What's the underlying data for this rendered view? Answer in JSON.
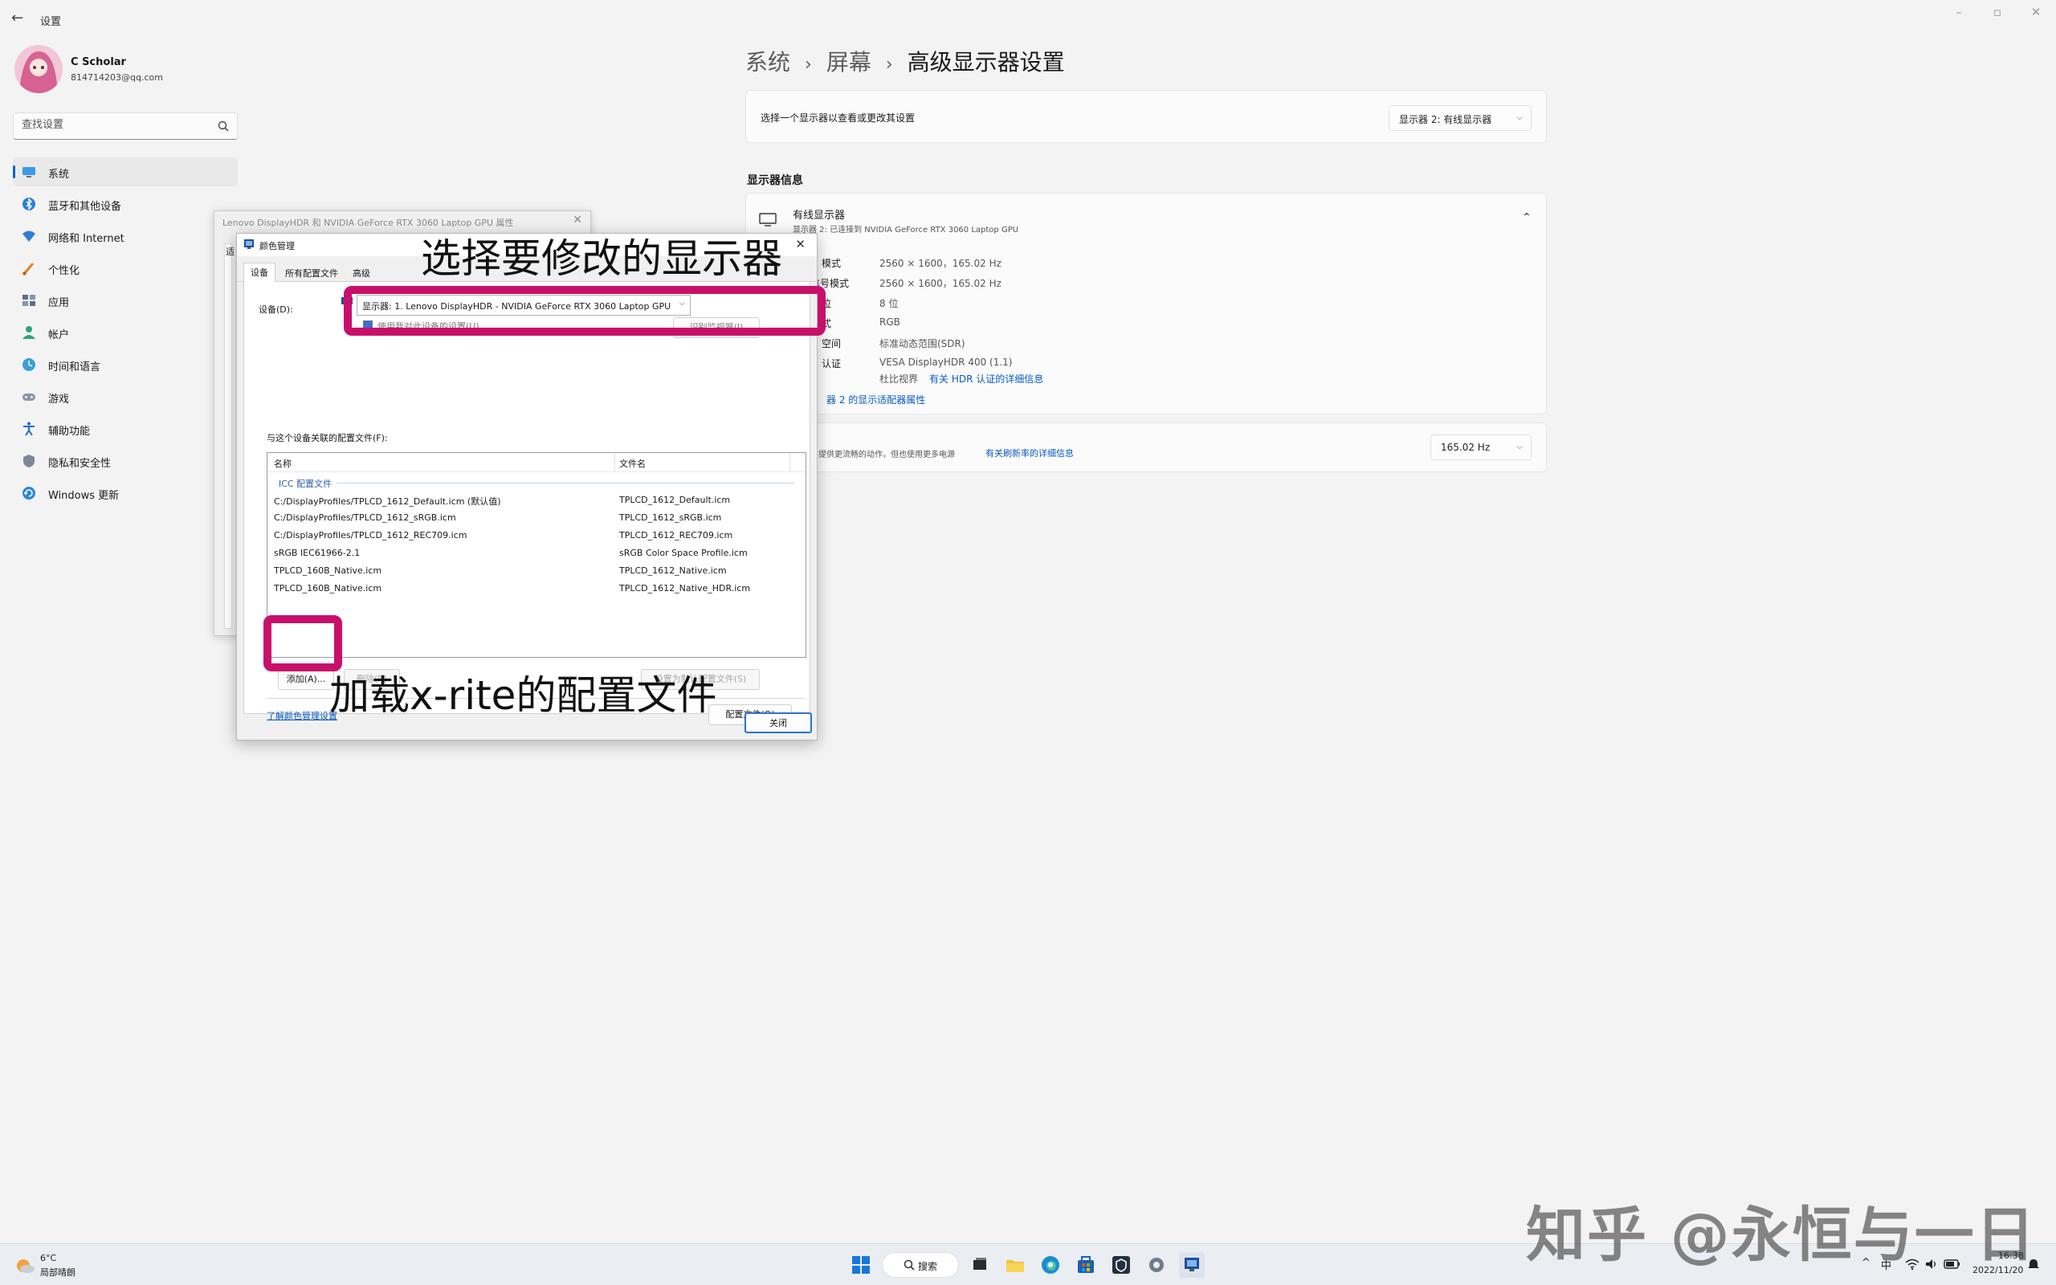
{
  "app": {
    "back_glyph": "←",
    "title": "设置",
    "minimize": "–",
    "maximize": "▫",
    "close": "✕"
  },
  "user": {
    "name": "C Scholar",
    "email": "814714203@qq.com"
  },
  "search": {
    "placeholder": "查找设置",
    "icon": "search-icon"
  },
  "nav": [
    {
      "label": "系统",
      "icon": "monitor-icon",
      "active": true
    },
    {
      "label": "蓝牙和其他设备",
      "icon": "bluetooth-icon"
    },
    {
      "label": "网络和 Internet",
      "icon": "wifi-icon"
    },
    {
      "label": "个性化",
      "icon": "brush-icon"
    },
    {
      "label": "应用",
      "icon": "apps-icon"
    },
    {
      "label": "帐户",
      "icon": "account-icon"
    },
    {
      "label": "时间和语言",
      "icon": "globe-clock-icon"
    },
    {
      "label": "游戏",
      "icon": "gamepad-icon"
    },
    {
      "label": "辅助功能",
      "icon": "accessibility-icon"
    },
    {
      "label": "隐私和安全性",
      "icon": "shield-icon"
    },
    {
      "label": "Windows 更新",
      "icon": "update-icon"
    }
  ],
  "breadcrumb": {
    "part1": "系统",
    "part2": "屏幕",
    "current": "高级显示器设置",
    "separator": "›"
  },
  "display_select": {
    "label": "选择一个显示器以查看或更改其设置",
    "value": "显示器 2: 有线显示器"
  },
  "display_info": {
    "section_title": "显示器信息",
    "monitor_name": "有线显示器",
    "monitor_sub": "显示器 2: 已连接到 NVIDIA GeForce RTX 3060 Laptop GPU",
    "rows": [
      {
        "label": "模式",
        "value": "2560 × 1600，165.02 Hz"
      },
      {
        "label": "信号模式",
        "value": "2560 × 1600，165.02 Hz"
      },
      {
        "label": "位",
        "value": "8 位"
      },
      {
        "label": "式",
        "value": "RGB"
      },
      {
        "label": "空间",
        "value": "标准动态范围(SDR)"
      },
      {
        "label": "认证",
        "value": "VESA DisplayHDR 400 (1.1)"
      }
    ],
    "contrast_label": "杜比视界",
    "hdr_link": "有关 HDR 认证的详细信息",
    "adapter_link": "器 2 的显示适配器属性"
  },
  "refresh": {
    "text": "提供更流畅的动作，但也使用更多电源",
    "link": "有关刷新率的详细信息",
    "value": "165.02 Hz"
  },
  "prop_dialog": {
    "title": "Lenovo DisplayHDR 和 NVIDIA GeForce RTX 3060 Laptop GPU 属性",
    "close": "✕",
    "partial_tab": "适"
  },
  "color_mgmt": {
    "title": "颜色管理",
    "close": "✕",
    "tabs": [
      "设备",
      "所有配置文件",
      "高级"
    ],
    "device_label": "设备(D):",
    "device_value": "显示器: 1. Lenovo DisplayHDR - NVIDIA GeForce RTX 3060 Laptop GPU",
    "use_settings_checkbox": "使用我对此设备的设置(U)",
    "identify_button": "识别监视器(I)",
    "profiles_label": "与这个设备关联的配置文件(F):",
    "col_name": "名称",
    "col_file": "文件名",
    "group": "ICC 配置文件",
    "profiles": [
      {
        "name": "C:/DisplayProfiles/TPLCD_1612_Default.icm (默认值)",
        "file": "TPLCD_1612_Default.icm"
      },
      {
        "name": "C:/DisplayProfiles/TPLCD_1612_sRGB.icm",
        "file": "TPLCD_1612_sRGB.icm"
      },
      {
        "name": "C:/DisplayProfiles/TPLCD_1612_REC709.icm",
        "file": "TPLCD_1612_REC709.icm"
      },
      {
        "name": "sRGB IEC61966-2.1",
        "file": "sRGB Color Space Profile.icm"
      },
      {
        "name": "TPLCD_160B_Native.icm",
        "file": "TPLCD_1612_Native.icm"
      },
      {
        "name": "TPLCD_160B_Native.icm",
        "file": "TPLCD_1612_Native_HDR.icm"
      }
    ],
    "add_button": "添加(A)...",
    "remove_button": "删除(R)",
    "set_default_button": "设置为默认配置文件(S)",
    "learn_link": "了解颜色管理设置",
    "profiles_button": "配置文件(O)",
    "close_button": "关闭"
  },
  "annotations": {
    "top": "选择要修改的显示器",
    "bottom": "加载x-rite的配置文件",
    "highlight_color": "#c8106b"
  },
  "taskbar": {
    "weather_temp": "6°C",
    "weather_desc": "局部晴朗",
    "search_label": "搜索",
    "tray_ime": "中",
    "time": "16:38",
    "date": "2022/11/20",
    "overflow": "^"
  },
  "watermark": "知乎 @永恒与一日"
}
